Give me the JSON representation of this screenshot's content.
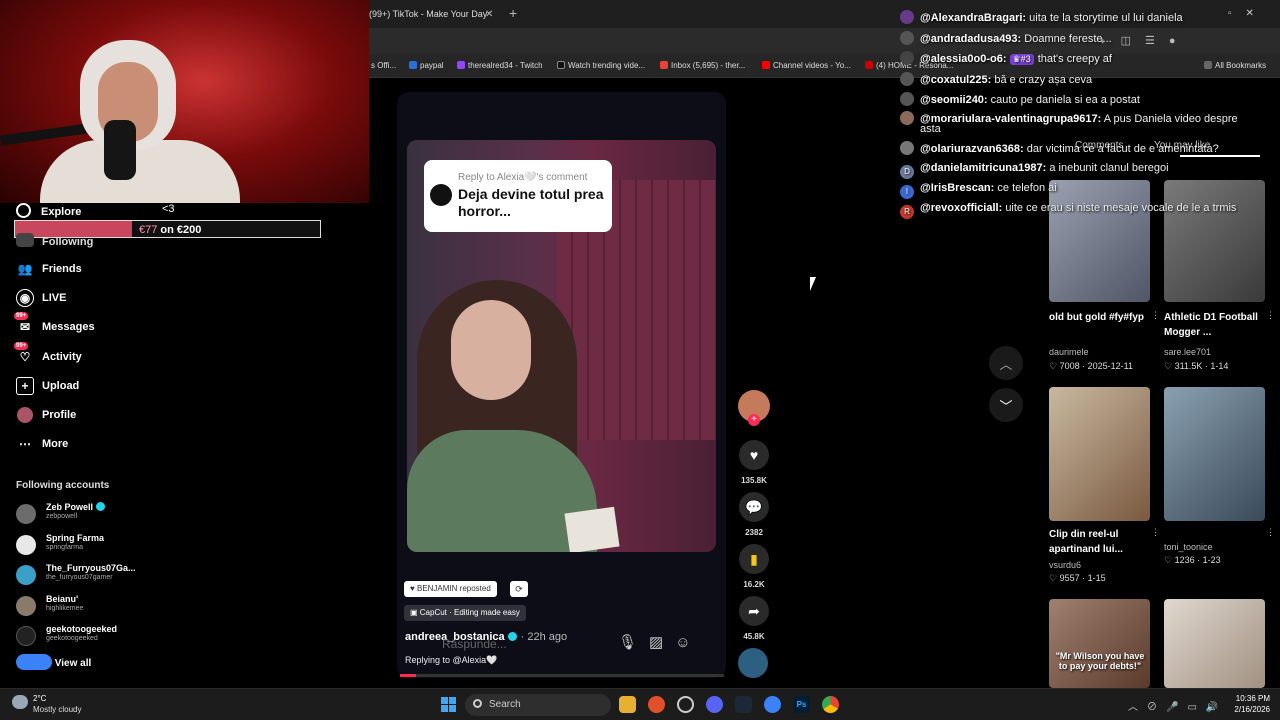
{
  "browser": {
    "active_tab": "(99+) TikTok - Make Your Day",
    "bookmarks": [
      "s Offi...",
      "paypal",
      "therealred34 - Twitch",
      "Watch trending vide...",
      "Inbox (5,695) - ther...",
      "Channel videos - Yo...",
      "(4) HOME - Resona...",
      "All Bookmarks"
    ]
  },
  "donation": {
    "raised": "€77",
    "goal_text": "on €200",
    "progress": 0.385
  },
  "sidebar": {
    "explore": "Explore",
    "explore_extra": "<3",
    "following": "Following",
    "items": [
      {
        "label": "Friends",
        "icon": "friends-icon"
      },
      {
        "label": "LIVE",
        "icon": "live-icon"
      },
      {
        "label": "Messages",
        "icon": "messages-icon",
        "badge": "99+"
      },
      {
        "label": "Activity",
        "icon": "activity-icon",
        "badge": "99+"
      },
      {
        "label": "Upload",
        "icon": "upload-icon"
      },
      {
        "label": "Profile",
        "icon": "profile-icon"
      },
      {
        "label": "More",
        "icon": "more-icon"
      }
    ],
    "following_title": "Following accounts",
    "accounts": [
      {
        "name": "Zeb Powell",
        "handle": "zebpowell",
        "verified": true,
        "color": "#6c6c6c"
      },
      {
        "name": "Spring Farma",
        "handle": "springfarma",
        "verified": false,
        "color": "#e8e8e8"
      },
      {
        "name": "The_Furryous07Ga...",
        "handle": "the_furryous07gamer",
        "verified": false,
        "color": "#3aa0c8"
      },
      {
        "name": "Beianu'",
        "handle": "highlikemee",
        "verified": false,
        "color": "#8a7a6a"
      },
      {
        "name": "geekotoogeeked",
        "handle": "geekotoogeeked",
        "verified": false,
        "color": "#222"
      }
    ],
    "view_all": "View all"
  },
  "video": {
    "reply_to": "Reply to Alexia🤍's comment",
    "comment_text": "Deja devine totul prea horror...",
    "reposted": "BENJAMIN reposted",
    "capcut": "CapCut · Editing made easy",
    "author": "andreea_bostanica",
    "ago": "· 22h ago",
    "reply_placeholder": "Răspunde...",
    "replying_to": "Replying to @Alexia🤍",
    "progress": 0.05
  },
  "rail": {
    "likes": "135.8K",
    "comments": "2382",
    "saves": "16.2K",
    "shares": "45.8K"
  },
  "chat": [
    {
      "user": "@AlexandraBragari:",
      "msg": "uita te la storytime ul lui daniela",
      "avatar_color": "#6a3a8a"
    },
    {
      "user": "@andradadusa493:",
      "msg": "Doamne fereste...",
      "avatar_color": "#555"
    },
    {
      "user": "@alessia0o0-o6:",
      "msg": "that's creepy af",
      "vip": "♛#3",
      "avatar_color": "#444"
    },
    {
      "user": "@coxatul225:",
      "msg": "bă e crazy așa ceva",
      "avatar_color": "#555"
    },
    {
      "user": "@seomii240:",
      "msg": "cauto pe daniela si ea a postat",
      "avatar_color": "#555"
    },
    {
      "user": "@morariulara-valentinagrupa9617:",
      "msg": "A pus Daniela video despre",
      "msg2": "asta",
      "avatar_color": "#8a6a5a"
    },
    {
      "user": "@olariurazvan6368:",
      "msg": "dar victima ce a facut de e amenintata?",
      "avatar_color": "#777"
    },
    {
      "user": "@danielamitricuna1987:",
      "msg": "a inebunit clanul beregoi",
      "avatar_color": "#6a7a9a",
      "letter": "D"
    },
    {
      "user": "@IrisBrescan:",
      "msg": "ce telefon ai",
      "avatar_color": "#3a6ad0",
      "letter": "I"
    },
    {
      "user": "@revoxofficiall:",
      "msg": "uite ce erau si niste mesaje vocale de le a trmis",
      "avatar_color": "#c0392b",
      "letter": "R"
    }
  ],
  "right_tabs": [
    "Comments",
    "You may like"
  ],
  "recommended": [
    {
      "title": "old but gold #fy#fyp",
      "author": "daurimele",
      "stats": "♡ 7008 · 2025-12-11",
      "color": "#8a8a9a"
    },
    {
      "title": "Athletic D1 Football Mogger ...",
      "author": "sare.lee701",
      "stats": "♡ 311.5K · 1-14",
      "color": "#6a6a6a"
    },
    {
      "title": "Clip din reel-ul apartinand lui...",
      "author": "vsurdu6",
      "stats": "♡ 9557 · 1-15",
      "color": "#b0a090"
    },
    {
      "title": "",
      "author": "toni_toonice",
      "stats": "♡ 1236 · 1-23",
      "color": "#4a5a6a"
    },
    {
      "title": "",
      "author": "",
      "stats": "",
      "caption": "\"Mr Wilson you have to pay your debts!\"",
      "color": "#8a6a5a"
    },
    {
      "title": "",
      "author": "",
      "stats": "",
      "color": "#c8b8a8"
    }
  ],
  "taskbar": {
    "temp": "2°C",
    "condition": "Mostly cloudy",
    "search": "Search",
    "time": "10:36 PM",
    "date": "2/16/2026"
  }
}
